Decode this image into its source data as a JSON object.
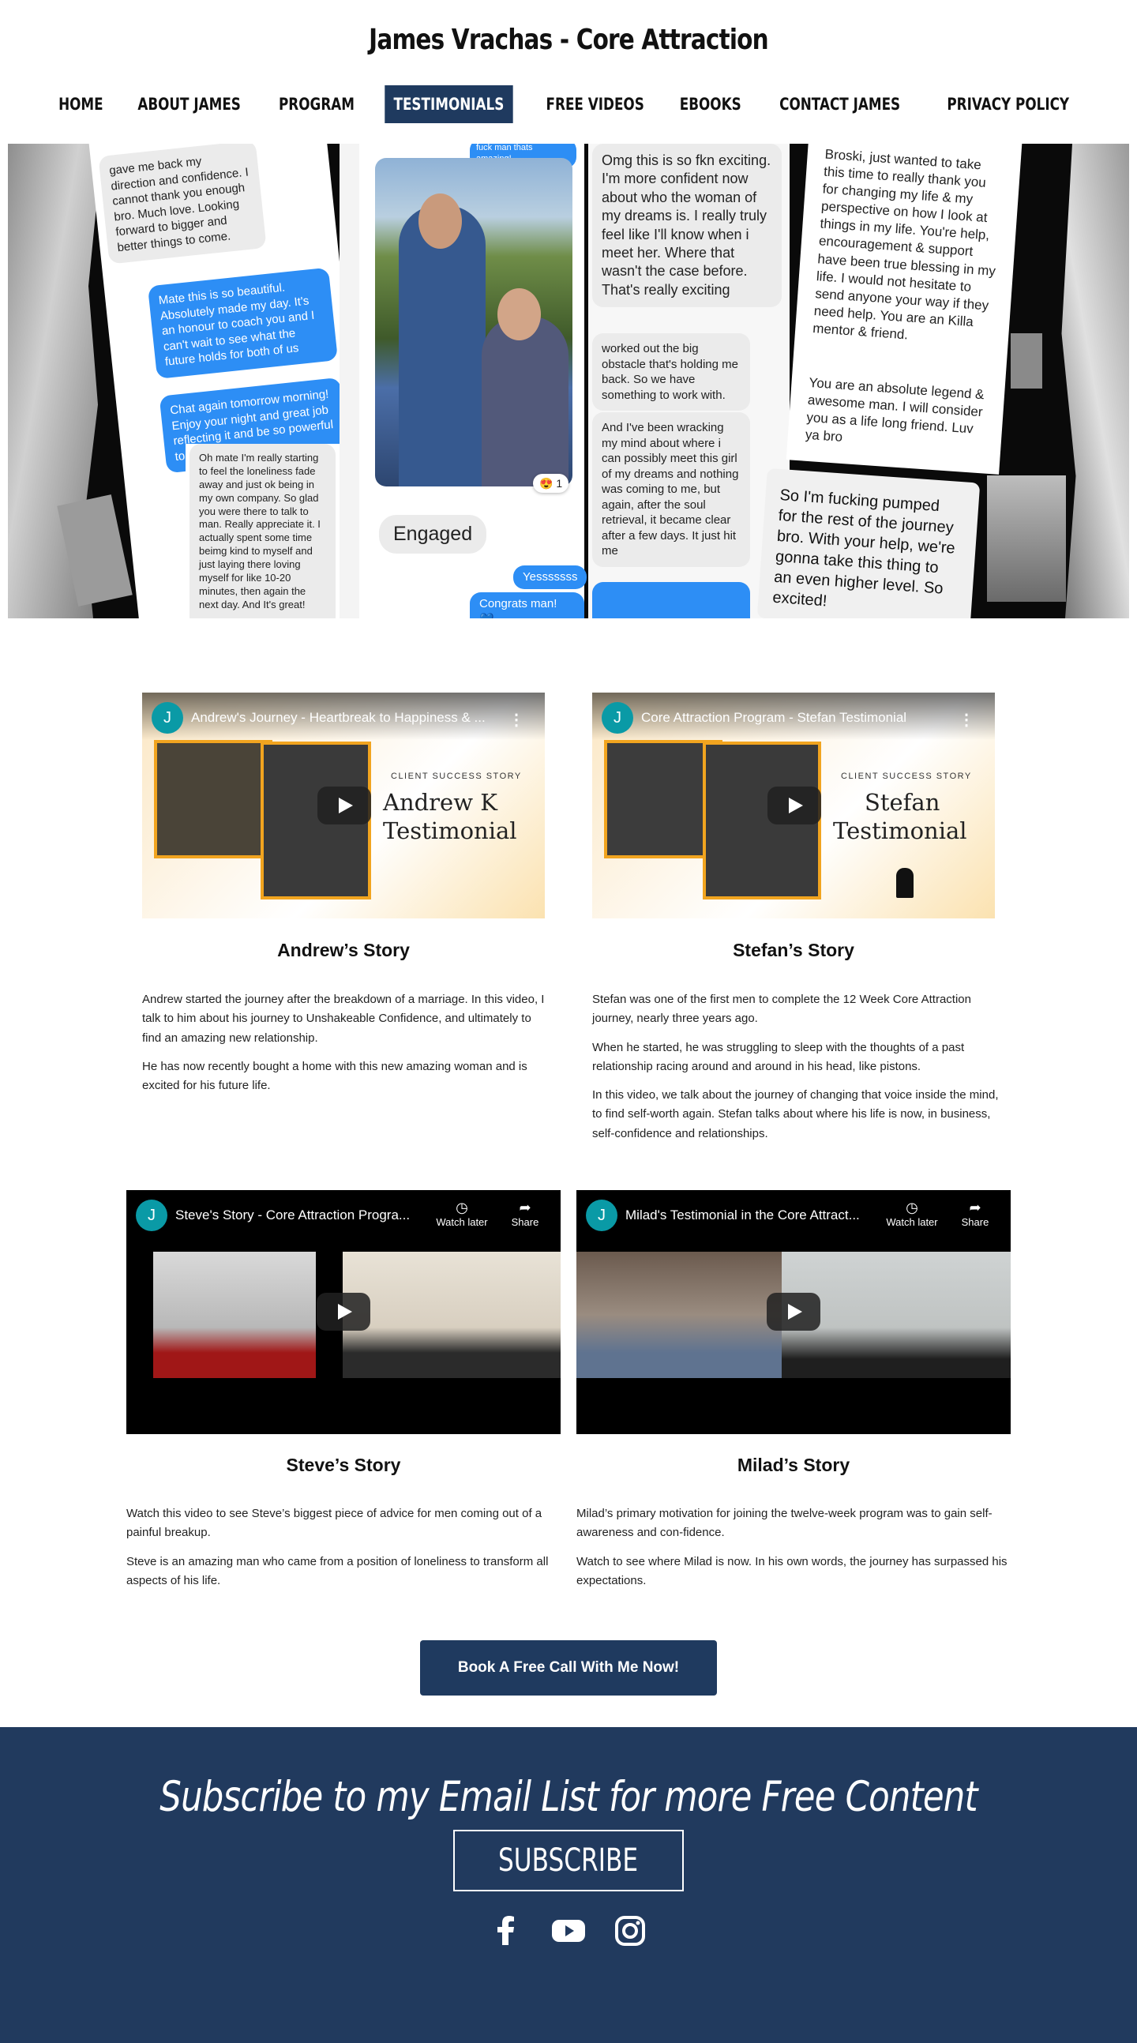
{
  "site": {
    "title": "James Vrachas - Core Attraction"
  },
  "nav": {
    "items": [
      "HOME",
      "ABOUT JAMES",
      "PROGRAM",
      "TESTIMONIALS",
      "FREE VIDEOS",
      "EBOOKS",
      "CONTACT JAMES",
      "PRIVACY POLICY"
    ],
    "active": "TESTIMONIALS"
  },
  "hero": {
    "msg_top_left": "gave me back my direction and confidence. I cannot thank you enough bro. Much love. Looking forward to bigger and better things to come.",
    "msg_blue_1": "Mate this is so beautiful. Absolutely made my day. It's an honour to coach you and I can't wait to see what the future holds for both of us",
    "msg_blue_2": "Chat again tomorrow morning! Enjoy your night and great job reflecting it and be so powerful to do",
    "msg_lonely": "Oh mate I'm really starting to feel the loneliness fade away and just ok being in my own company. So glad you were there to talk to man. Really appreciate it. I actually spent some time beimg kind to myself and just laying there loving myself for like 10-20 minutes, then again the next day. And It's great!",
    "msg_engaged": "Engaged",
    "msg_yes": "Yesssssss",
    "msg_congrats": "Congrats man! 💙",
    "msg_top_blue": "fuck man thats amazing!",
    "msg_omg": "Omg this is so fkn exciting. I'm more confident now about who the woman of my dreams is. I really truly feel like I'll know when i meet her. Where that wasn't the case before. That's really exciting",
    "msg_obstacle": "worked out the big obstacle that's holding me back. So we have something to work with.",
    "msg_wracking": "And I've been wracking my mind about where i can possibly meet this girl of my dreams and nothing was coming to me, but again, after the soul retrieval, it became clear after a few days. It just hit me",
    "msg_broski": "Broski, just wanted to take this time to really thank you for changing my life & my perspective on how I look at things in my life. You're help, encouragement & support have been true blessing in my life. I would not hesitate to send anyone your way if they need help.  You are an Killa mentor & friend.",
    "msg_legend": "You are an absolute legend & awesome man. I will consider you as a life long friend. Luv ya bro",
    "msg_pumped": "So I'm fucking pumped for the rest of the journey bro. With your help, we're gonna take this thing to an even higher level. So excited!",
    "reaction": "😍 1"
  },
  "stories": [
    {
      "video_title": "Andrew's Journey - Heartbreak to Happiness & ...",
      "thumb_tag": "CLIENT SUCCESS STORY",
      "thumb_name": "Andrew K",
      "thumb_sub": "Testimonial",
      "title": "Andrew’s Story",
      "paragraphs": [
        "Andrew started the journey after the breakdown of a marriage. In this video, I talk to him about his journey to Unshakeable Confidence, and ultimately to find an amazing new relationship.",
        "He has now recently bought a home with this new amazing woman and is excited for his future life."
      ]
    },
    {
      "video_title": "Core Attraction Program - Stefan Testimonial",
      "thumb_tag": "CLIENT SUCCESS STORY",
      "thumb_name": "Stefan",
      "thumb_sub": "Testimonial",
      "title": "Stefan’s Story",
      "paragraphs": [
        "Stefan was one of the first men to complete the 12 Week Core Attraction journey, nearly three years ago.",
        "When he started, he was struggling to sleep with the thoughts of a past relationship racing around and around in his head, like pistons.",
        "In this video, we talk about the journey of changing that voice inside the mind, to find self-worth again. Stefan talks about where his life is now, in business, self-confidence and relationships."
      ]
    },
    {
      "video_title": "Steve's Story - Core Attraction Progra...",
      "title": "Steve’s Story",
      "paragraphs": [
        "Watch this video to see Steve’s biggest piece of advice for men coming out of a painful breakup.",
        "Steve is an amazing man who came from a position of loneliness to transform all aspects of his life."
      ]
    },
    {
      "video_title": "Milad's Testimonial in the Core Attract...",
      "title": "Milad’s Story",
      "paragraphs": [
        "Milad’s primary motivation for joining the twelve-week program was to gain self-awareness and con-fidence.",
        "Watch to see where Milad is now. In his own words, the journey has surpassed his expectations."
      ]
    }
  ],
  "video_ui": {
    "avatar_letter": "J",
    "watch_later": "Watch later",
    "share": "Share"
  },
  "cta": {
    "label": "Book A Free Call With Me Now!"
  },
  "footer": {
    "heading": "Subscribe to my Email List for more Free Content",
    "button": "SUBSCRIBE",
    "social": [
      "facebook-icon",
      "youtube-icon",
      "instagram-icon"
    ]
  },
  "colors": {
    "navy": "#1f3a5f",
    "footer": "#213a5e",
    "imessage_blue": "#2d8ef5",
    "yt_teal": "#0a9aa6"
  }
}
